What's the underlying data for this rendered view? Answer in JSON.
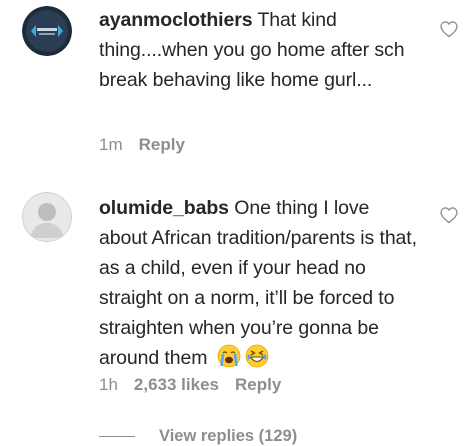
{
  "comments": [
    {
      "username": "ayanmoclothiers",
      "text": "That kind thing....when you go home after sch break behaving like home gurl...",
      "time": "1m",
      "likes": "",
      "reply_label": "Reply",
      "avatar_icon": "brand-logo-avatar",
      "like_icon": "heart-outline-icon"
    },
    {
      "username": "olumide_babs",
      "text": "One thing I love about African tradition/parents is that, as a child, even if your head no straight on a norm, it’ll be forced to straighten when you’re gonna be around them",
      "emojis": [
        "loudly-crying-face-emoji",
        "grinning-squinting-face-emoji"
      ],
      "time": "1h",
      "likes": "2,633 likes",
      "reply_label": "Reply",
      "avatar_icon": "profile-photo-avatar",
      "like_icon": "heart-outline-icon"
    }
  ],
  "view_replies_label": "View replies (129)",
  "colors": {
    "text": "#262626",
    "secondary": "#8e8e8e",
    "background": "#ffffff"
  }
}
